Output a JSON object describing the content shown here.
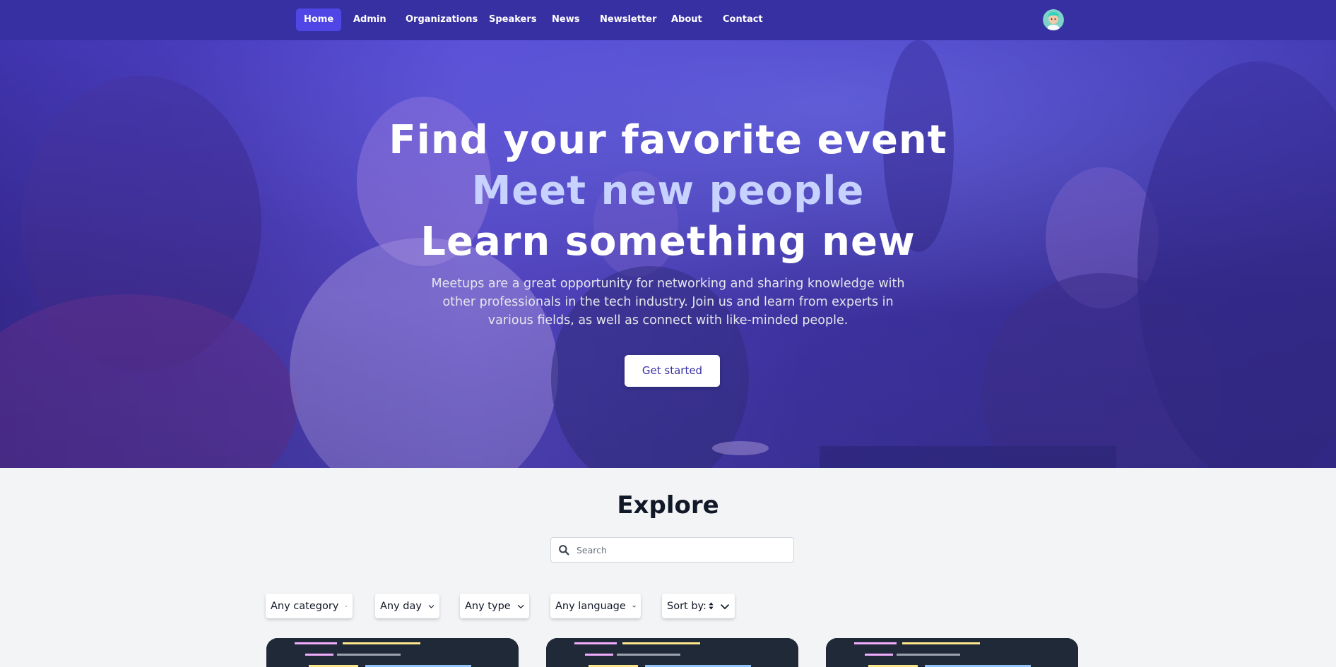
{
  "nav": {
    "items": [
      {
        "label": "Home",
        "active": true
      },
      {
        "label": "Admin"
      },
      {
        "label": "Organizations"
      },
      {
        "label": "Speakers"
      },
      {
        "label": "News"
      },
      {
        "label": "Newsletter"
      },
      {
        "label": "About"
      },
      {
        "label": "Contact"
      }
    ]
  },
  "hero": {
    "line1": "Find your favorite event",
    "line2": "Meet new people",
    "line3": "Learn something new",
    "description": "Meetups are a great opportunity for networking and sharing knowledge with other professionals in the tech industry. Join us and learn from experts in various fields, as well as connect with like-minded people.",
    "cta_label": "Get started"
  },
  "explore": {
    "title": "Explore",
    "search_placeholder": "Search",
    "filters": [
      {
        "label": "Any category"
      },
      {
        "label": "Any day"
      },
      {
        "label": "Any type"
      },
      {
        "label": "Any language"
      },
      {
        "label": "Sort by:"
      }
    ]
  },
  "colors": {
    "navbar": "#3730a3",
    "active_nav": "#4f46e5",
    "accent_line": "#c7d2fe",
    "page_bg": "#f3f4f6"
  },
  "icons": [
    "user-avatar",
    "search-icon",
    "chevron-down-icon",
    "sort-icon"
  ]
}
